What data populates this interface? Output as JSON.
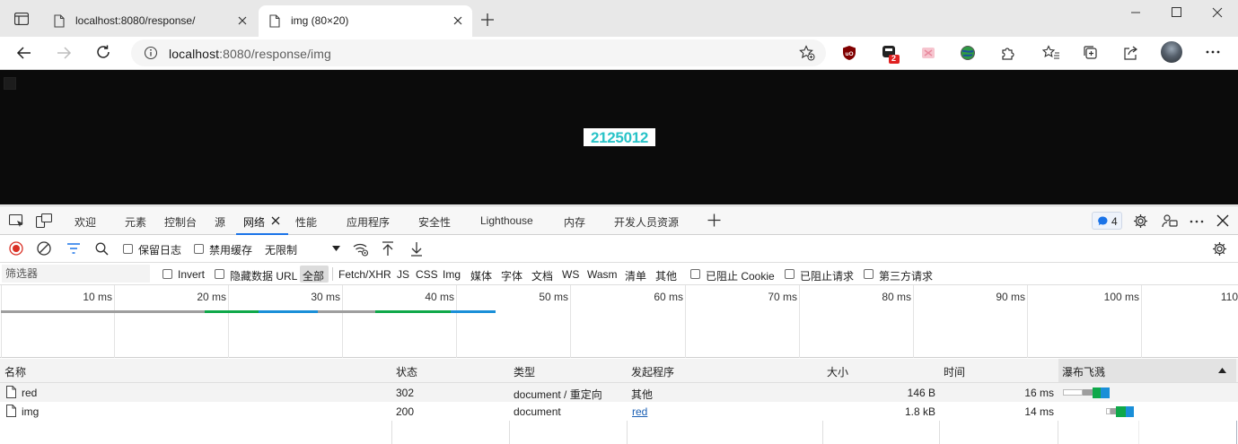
{
  "browser": {
    "tabs": [
      {
        "title": "localhost:8080/response/",
        "active": false
      },
      {
        "title": "img (80×20)",
        "active": true
      }
    ],
    "address": {
      "host": "localhost",
      "path": ":8080/response/img"
    },
    "extension_badge": "2"
  },
  "page": {
    "image_text": "2125012",
    "background": "#0b0b0b",
    "image_text_color": "#28c3c8"
  },
  "devtools": {
    "tabs": [
      "欢迎",
      "元素",
      "控制台",
      "源",
      "网络",
      "性能",
      "应用程序",
      "安全性",
      "Lighthouse",
      "内存",
      "开发人员资源"
    ],
    "active_tab": "网络",
    "issues_count": "4",
    "toolbar": {
      "preserve_log": "保留日志",
      "disable_cache": "禁用缓存",
      "throttle": "无限制"
    },
    "filter": {
      "placeholder": "筛选器",
      "invert": "Invert",
      "hide_data_urls": "隐藏数据 URL",
      "types": [
        "全部",
        "Fetch/XHR",
        "JS",
        "CSS",
        "Img",
        "媒体",
        "字体",
        "文档",
        "WS",
        "Wasm",
        "清单",
        "其他"
      ],
      "blocked_cookies": "已阻止 Cookie",
      "blocked_requests": "已阻止请求",
      "third_party": "第三方请求"
    },
    "overview": {
      "ticks": [
        "10 ms",
        "20 ms",
        "30 ms",
        "40 ms",
        "50 ms",
        "60 ms",
        "70 ms",
        "80 ms",
        "90 ms",
        "100 ms",
        "110"
      ]
    },
    "table": {
      "headers": [
        "名称",
        "状态",
        "类型",
        "发起程序",
        "大小",
        "时间",
        "瀑布飞溅"
      ],
      "rows": [
        {
          "name": "red",
          "status": "302",
          "type": "document / 重定向",
          "initiator": "其他",
          "size": "146 B",
          "time": "16 ms"
        },
        {
          "name": "img",
          "status": "200",
          "type": "document",
          "initiator": "red",
          "size": "1.8 kB",
          "time": "14 ms"
        }
      ]
    },
    "colors": {
      "accent": "#1a73e8",
      "record_red": "#d93025",
      "waterfall_green": "#0fa84a",
      "waterfall_blue": "#1a8fd8"
    }
  }
}
